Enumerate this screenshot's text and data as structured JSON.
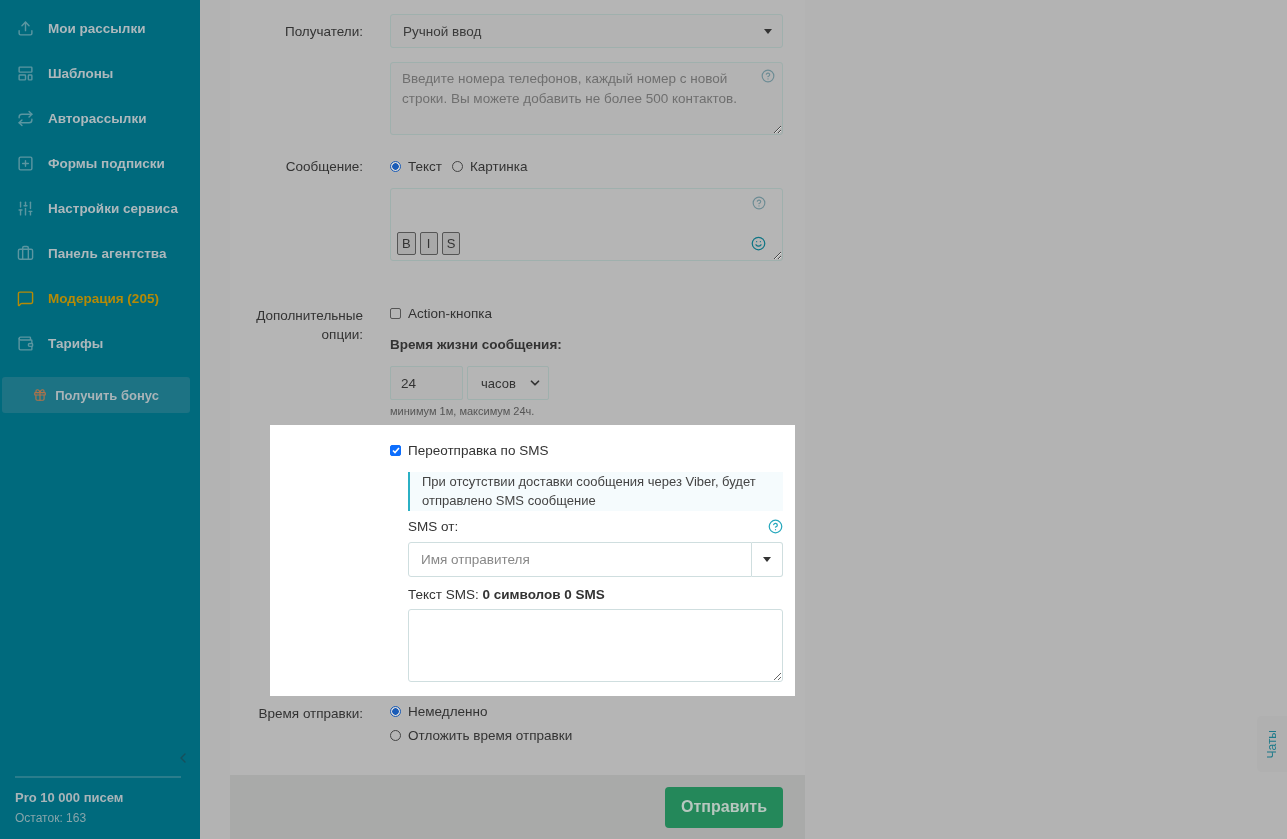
{
  "sidebar": {
    "items": [
      {
        "label": "Мои рассылки",
        "kind": "upload",
        "highlighted": false
      },
      {
        "label": "Шаблоны",
        "kind": "template",
        "highlighted": false
      },
      {
        "label": "Авторассылки",
        "kind": "auto",
        "highlighted": false
      },
      {
        "label": "Формы подписки",
        "kind": "form",
        "highlighted": false
      },
      {
        "label": "Настройки сервиса",
        "kind": "settings",
        "highlighted": false
      },
      {
        "label": "Панель агентства",
        "kind": "briefcase",
        "highlighted": false
      },
      {
        "label": "Модерация (205)",
        "kind": "chat",
        "highlighted": true
      },
      {
        "label": "Тарифы",
        "kind": "wallet",
        "highlighted": false
      }
    ],
    "bonus_button": "Получить бонус",
    "plan": {
      "name": "Pro 10 000 писем",
      "remaining": "Остаток: 163"
    }
  },
  "form": {
    "recipients": {
      "label": "Получатели:",
      "value": "Ручной ввод"
    },
    "phones": {
      "placeholder": "Введите номера телефонов, каждый номер с новой строки. Вы можете добавить не более 500 контактов."
    },
    "message": {
      "label": "Сообщение:",
      "options": [
        {
          "label": "Текст",
          "selected": true
        },
        {
          "label": "Картинка",
          "selected": false
        }
      ],
      "format_buttons": [
        "B",
        "I",
        "S"
      ]
    },
    "extra": {
      "label": "Дополнительные опции:",
      "action_button": {
        "label": "Action-кнопка",
        "checked": false
      },
      "lifetime": {
        "label": "Время жизни сообщения:",
        "value": "24",
        "unit": "часов",
        "hint": "минимум 1м, максимум 24ч."
      }
    },
    "sms_resend": {
      "label": "Переотправка по SMS",
      "checked": true,
      "info": "При отсутствии доставки сообщения через Viber, будет отправлено SMS сообщение",
      "from": {
        "label": "SMS от:",
        "placeholder": "Имя отправителя"
      },
      "text": {
        "label": "Текст SMS: **0 символов 0 SMS**"
      }
    },
    "send_time": {
      "label": "Время отправки:",
      "options": [
        {
          "label": "Немедленно",
          "selected": true
        },
        {
          "label": "Отложить время отправки",
          "selected": false
        }
      ]
    },
    "submit": "Отправить"
  },
  "chat_tab": "Чаты"
}
